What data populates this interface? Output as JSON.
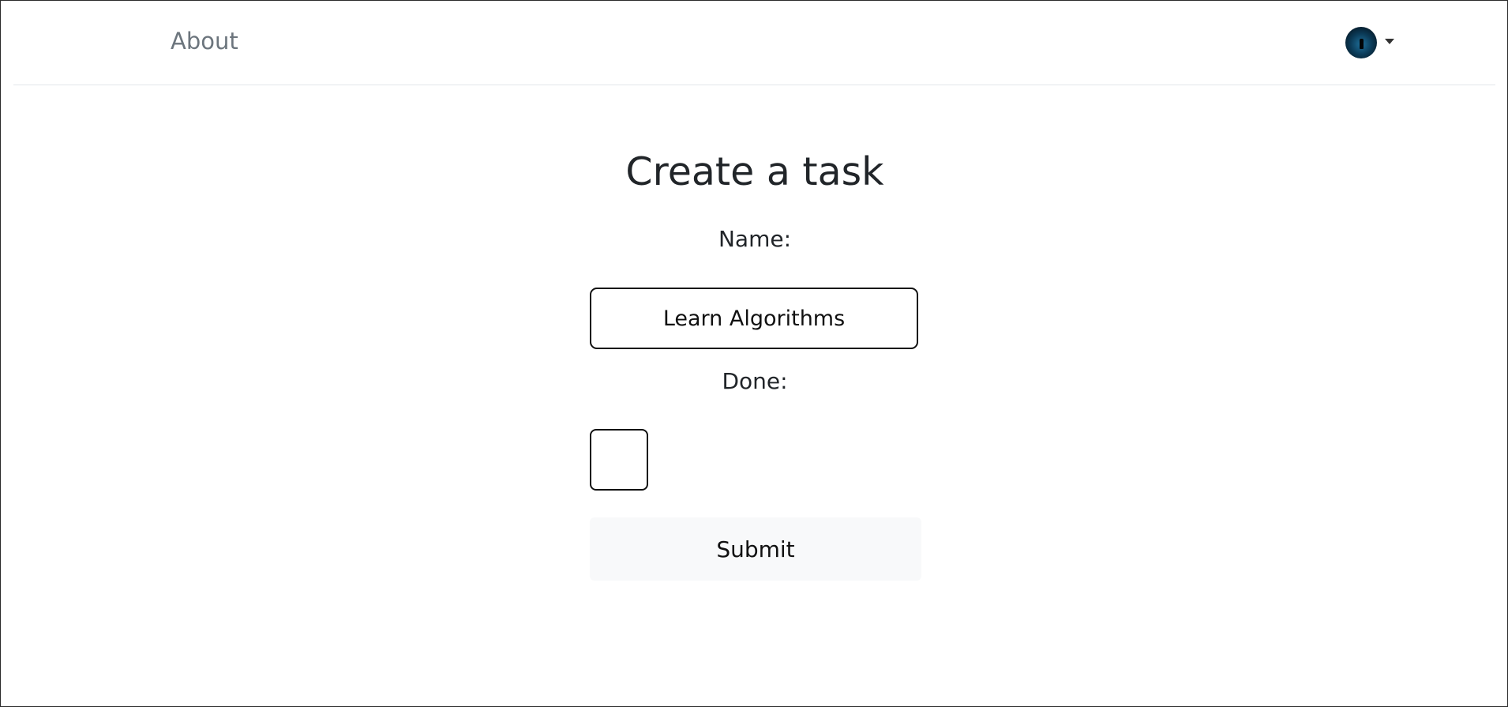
{
  "navbar": {
    "about_label": "About",
    "user_avatar_icon": "user-avatar-icon",
    "dropdown_icon": "caret-down-icon"
  },
  "form": {
    "title": "Create a task",
    "name_label": "Name:",
    "name_value": "Learn Algorithms",
    "done_label": "Done:",
    "done_checked": false,
    "submit_label": "Submit"
  },
  "colors": {
    "nav_link": "#6c757d",
    "text": "#212529",
    "submit_background": "#f8f9fa",
    "border": "#111111"
  }
}
